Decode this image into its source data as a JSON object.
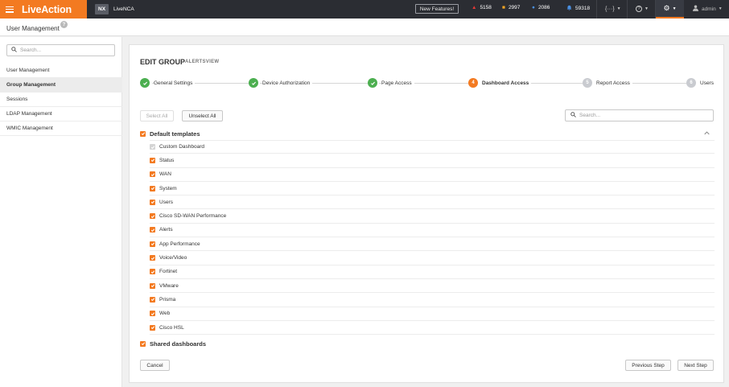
{
  "topbar": {
    "logo": "LiveAction",
    "nx_badge": "NX",
    "app_name": "LiveNCA",
    "new_features": "New Features!",
    "counters": [
      {
        "icon": "warning-triangle-icon",
        "color": "#e53935",
        "value": "5158"
      },
      {
        "icon": "square-icon",
        "color": "#f5a623",
        "value": "2997"
      },
      {
        "icon": "circle-icon",
        "color": "#4a90e2",
        "value": "2086"
      },
      {
        "icon": "bell-icon",
        "color": "#4a90e2",
        "value": "59318"
      }
    ],
    "user": "admin"
  },
  "page_header": {
    "title": "User Management"
  },
  "sidebar": {
    "search_placeholder": "Search...",
    "items": [
      {
        "label": "User Management",
        "active": false
      },
      {
        "label": "Group Management",
        "active": true
      },
      {
        "label": "Sessions",
        "active": false
      },
      {
        "label": "LDAP Management",
        "active": false
      },
      {
        "label": "WMIC Management",
        "active": false
      }
    ]
  },
  "panel": {
    "title": "EDIT GROUP",
    "subtitle": "ALERTSVIEW",
    "steps": [
      {
        "label": "General Settings",
        "state": "done",
        "number": "1"
      },
      {
        "label": "Device Authorization",
        "state": "done",
        "number": "2"
      },
      {
        "label": "Page Access",
        "state": "done",
        "number": "3"
      },
      {
        "label": "Dashboard Access",
        "state": "current",
        "number": "4"
      },
      {
        "label": "Report Access",
        "state": "todo",
        "number": "5"
      },
      {
        "label": "Users",
        "state": "todo",
        "number": "6"
      }
    ],
    "select_all": "Select All",
    "unselect_all": "Unselect All",
    "search_placeholder": "Search...",
    "groups": {
      "default": {
        "label": "Default templates",
        "items": [
          {
            "label": "Custom Dashboard",
            "disabled": true
          },
          {
            "label": "Status",
            "disabled": false
          },
          {
            "label": "WAN",
            "disabled": false
          },
          {
            "label": "System",
            "disabled": false
          },
          {
            "label": "Users",
            "disabled": false
          },
          {
            "label": "Cisco SD-WAN Performance",
            "disabled": false
          },
          {
            "label": "Alerts",
            "disabled": false
          },
          {
            "label": "App Performance",
            "disabled": false
          },
          {
            "label": "Voice/Video",
            "disabled": false
          },
          {
            "label": "Fortinet",
            "disabled": false
          },
          {
            "label": "VMware",
            "disabled": false
          },
          {
            "label": "Prisma",
            "disabled": false
          },
          {
            "label": "Web",
            "disabled": false
          },
          {
            "label": "Cisco HSL",
            "disabled": false
          }
        ]
      },
      "shared": {
        "label": "Shared dashboards"
      }
    },
    "cancel": "Cancel",
    "previous_step": "Previous Step",
    "next_step": "Next Step"
  },
  "colors": {
    "brand": "#f37a21",
    "done": "#4caf50",
    "todo": "#c9cbd0"
  }
}
